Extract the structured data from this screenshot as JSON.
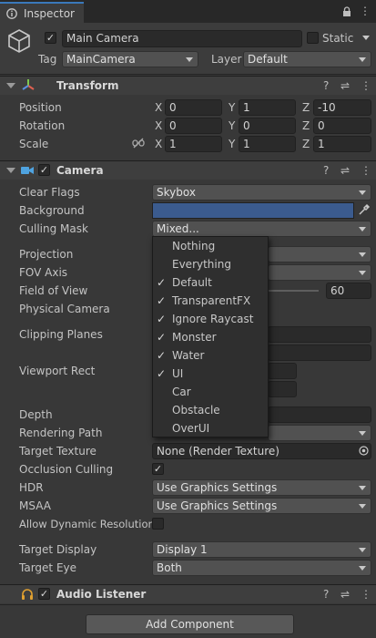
{
  "tab": {
    "title": "Inspector"
  },
  "gameobject": {
    "active": true,
    "name": "Main Camera",
    "static_label": "Static",
    "tag_label": "Tag",
    "tag_value": "MainCamera",
    "layer_label": "Layer",
    "layer_value": "Default"
  },
  "transform": {
    "title": "Transform",
    "position": {
      "label": "Position",
      "x": "0",
      "y": "1",
      "z": "-10"
    },
    "rotation": {
      "label": "Rotation",
      "x": "0",
      "y": "0",
      "z": "0"
    },
    "scale": {
      "label": "Scale",
      "x": "1",
      "y": "1",
      "z": "1"
    }
  },
  "axes": {
    "x": "X",
    "y": "Y",
    "z": "Z"
  },
  "camera": {
    "title": "Camera",
    "clear_flags": {
      "label": "Clear Flags",
      "value": "Skybox"
    },
    "background": {
      "label": "Background",
      "color": "#3b5b8e"
    },
    "culling_mask": {
      "label": "Culling Mask",
      "value": "Mixed..."
    },
    "projection": {
      "label": "Projection"
    },
    "fov_axis": {
      "label": "FOV Axis"
    },
    "field_of_view": {
      "label": "Field of View",
      "value": "60"
    },
    "physical_camera": {
      "label": "Physical Camera"
    },
    "clipping_planes": {
      "label": "Clipping Planes"
    },
    "viewport_rect": {
      "label": "Viewport Rect"
    },
    "depth": {
      "label": "Depth"
    },
    "rendering_path": {
      "label": "Rendering Path"
    },
    "target_texture": {
      "label": "Target Texture",
      "value": "None (Render Texture)"
    },
    "occlusion_culling": {
      "label": "Occlusion Culling",
      "checked": true
    },
    "hdr": {
      "label": "HDR",
      "value": "Use Graphics Settings"
    },
    "msaa": {
      "label": "MSAA",
      "value": "Use Graphics Settings"
    },
    "dynamic_resolution": {
      "label": "Allow Dynamic Resolution",
      "checked": false
    },
    "target_display": {
      "label": "Target Display",
      "value": "Display 1"
    },
    "target_eye": {
      "label": "Target Eye",
      "value": "Both"
    }
  },
  "culling_popup": {
    "items": [
      {
        "label": "Nothing",
        "checked": false
      },
      {
        "label": "Everything",
        "checked": false
      },
      {
        "label": "Default",
        "checked": true
      },
      {
        "label": "TransparentFX",
        "checked": true
      },
      {
        "label": "Ignore Raycast",
        "checked": true
      },
      {
        "label": "Monster",
        "checked": true
      },
      {
        "label": "Water",
        "checked": true
      },
      {
        "label": "UI",
        "checked": true
      },
      {
        "label": "Car",
        "checked": false
      },
      {
        "label": "Obstacle",
        "checked": false
      },
      {
        "label": "OverUI",
        "checked": false
      }
    ]
  },
  "audio_listener": {
    "title": "Audio Listener"
  },
  "add_component": {
    "label": "Add Component"
  },
  "colors": {
    "accent": "#3a79bb",
    "panel": "#383838",
    "header": "#3e3e3e"
  }
}
